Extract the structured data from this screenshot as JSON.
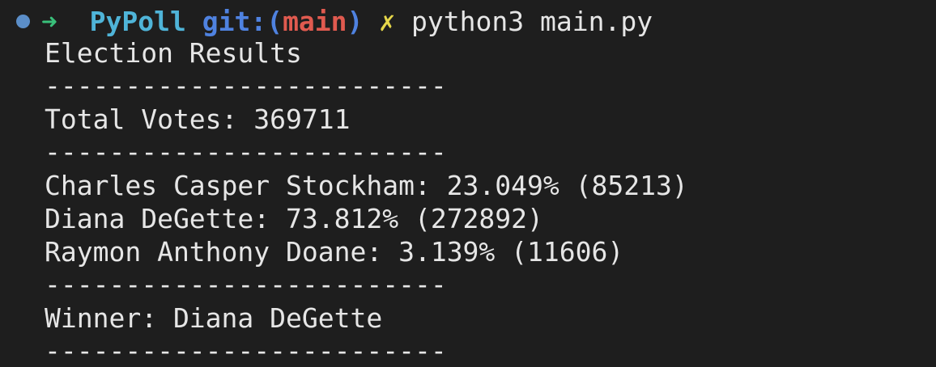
{
  "prompt": {
    "arrow": "➜",
    "directory": "PyPoll",
    "git_prefix": "git:(",
    "branch": "main",
    "git_suffix": ")",
    "dirty_mark": "✗",
    "command": "python3 main.py"
  },
  "output": {
    "title": "Election Results",
    "separator": "-------------------------",
    "total_votes": "Total Votes: 369711",
    "candidates": [
      "Charles Casper Stockham: 23.049% (85213)",
      "Diana DeGette: 73.812% (272892)",
      "Raymon Anthony Doane: 3.139% (11606)"
    ],
    "winner": "Winner: Diana DeGette"
  },
  "colors": {
    "background": "#1e1e1e",
    "foreground": "#e6e6e6",
    "arrow": "#39c07a",
    "directory": "#4fb4d8",
    "git": "#4f82e0",
    "branch": "#e05a4f",
    "dirty": "#e6d74a",
    "status_dot": "#5b8ec8"
  }
}
